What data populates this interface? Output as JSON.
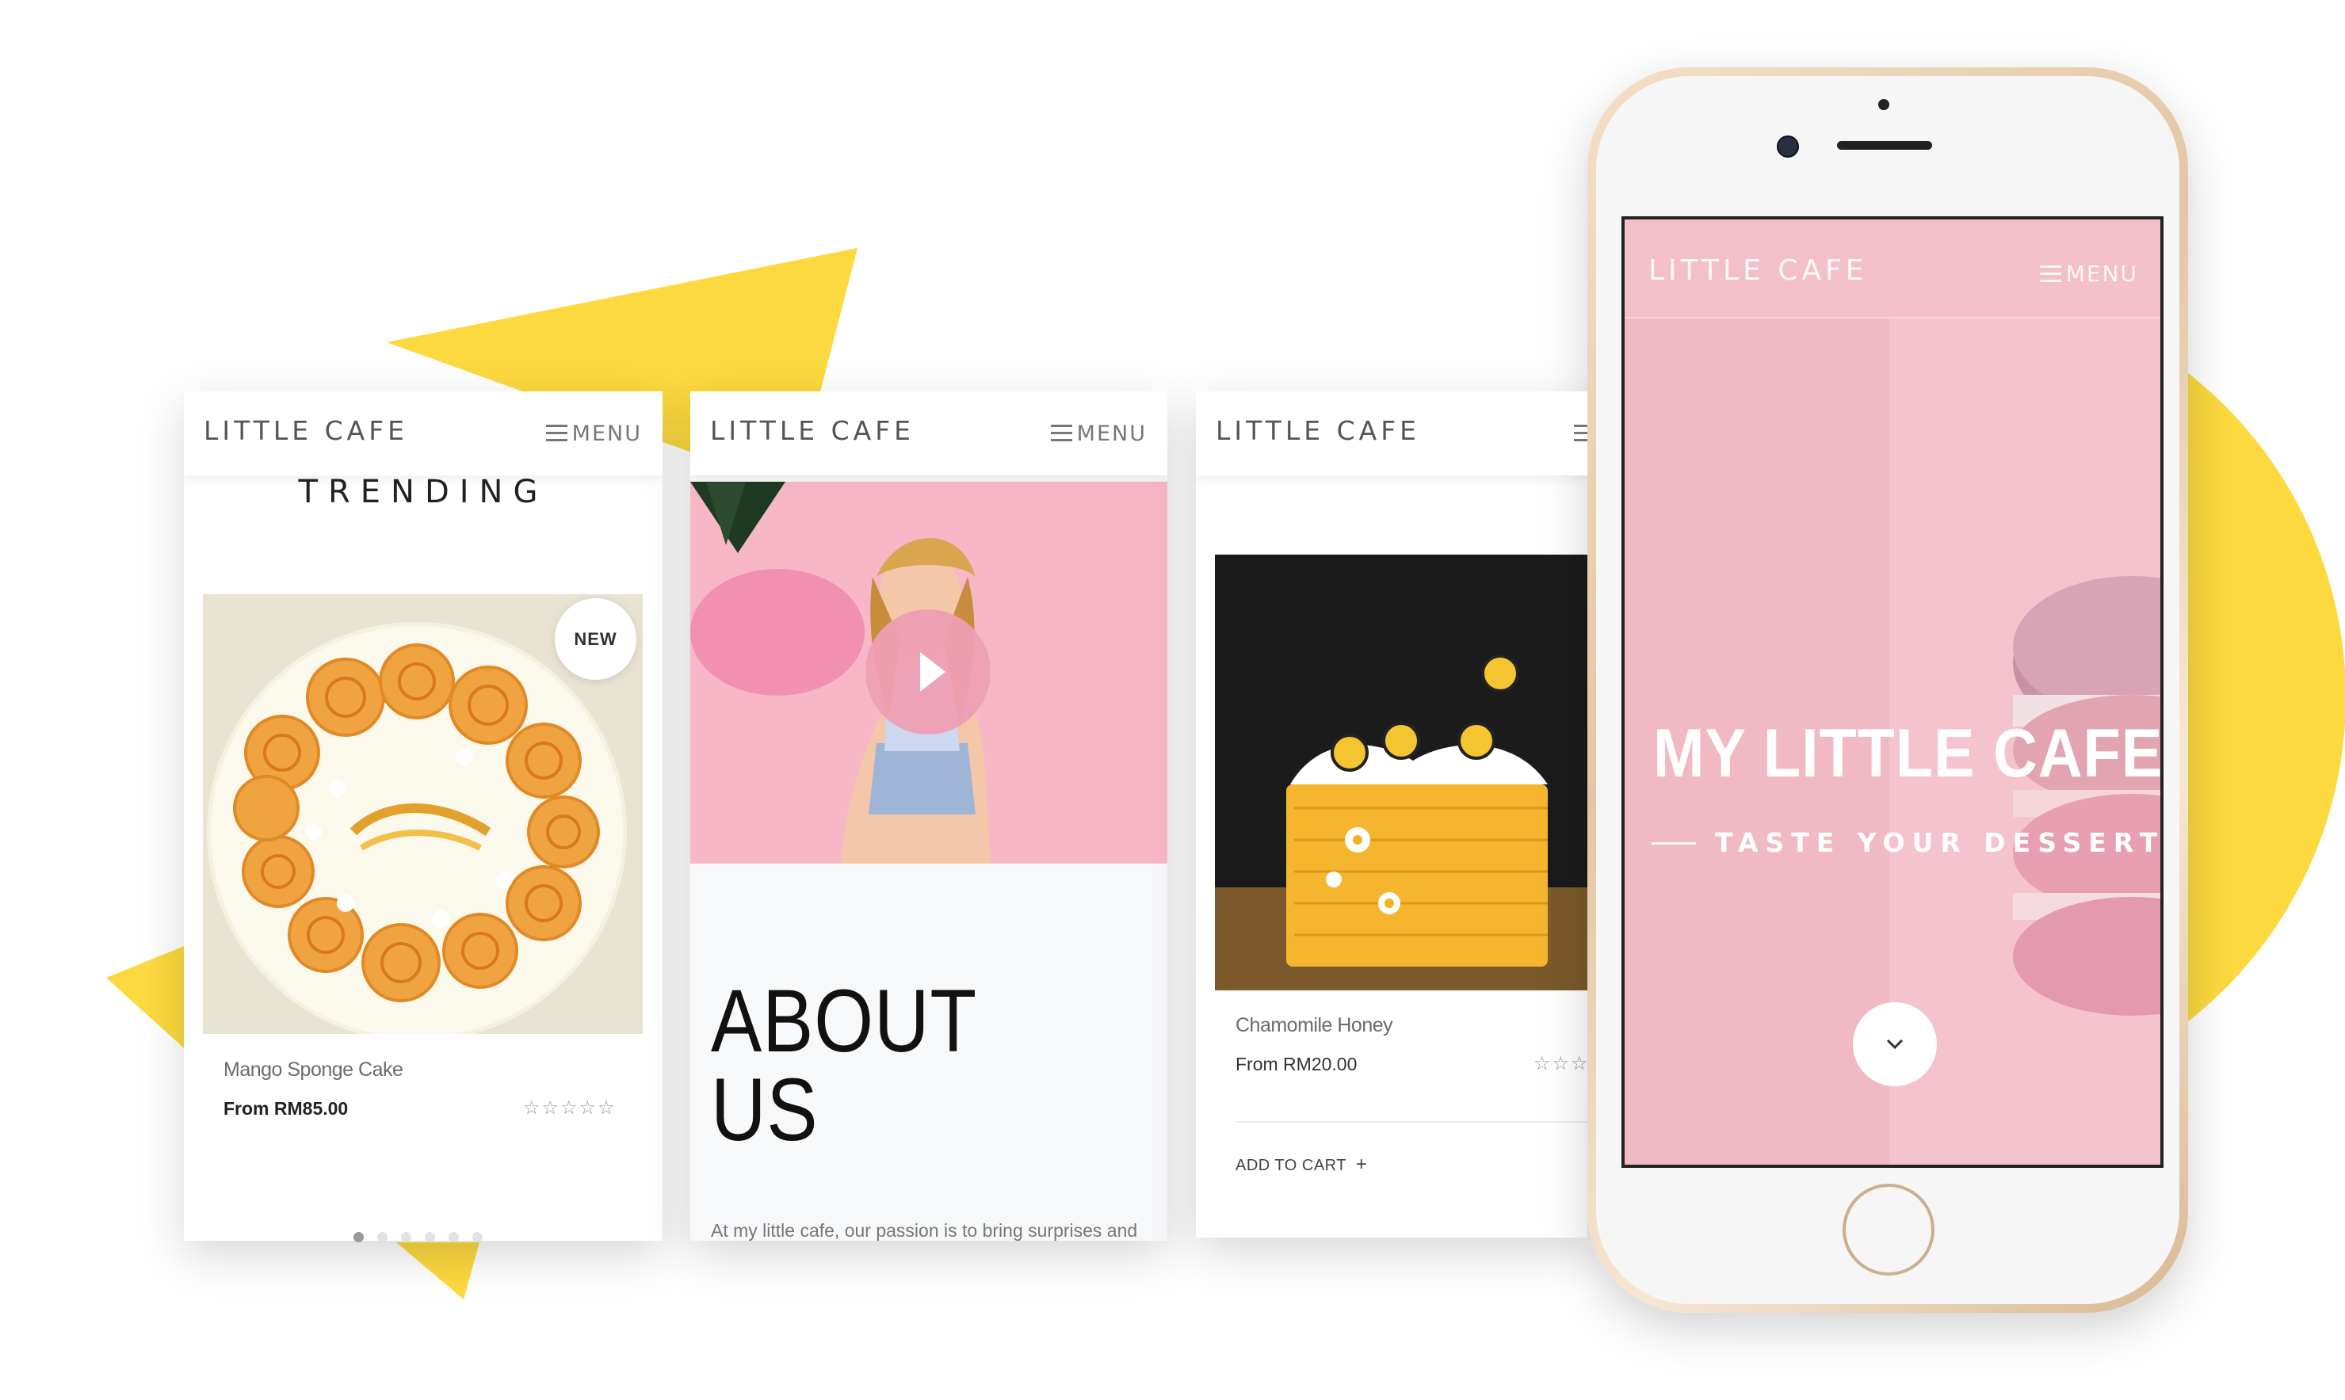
{
  "colors": {
    "accent_yellow": "#fcd93f",
    "hero_pink": "#f1b9c4",
    "video_pink": "#f7b7c6",
    "play_button": "#ee9fb4"
  },
  "screen_trending": {
    "brand": "LITTLE CAFE",
    "menu_label": "MENU",
    "section_title": "TRENDING",
    "badge": "NEW",
    "product_name": "Mango Sponge Cake",
    "product_price": "From RM85.00",
    "rating": "☆☆☆☆☆",
    "slide_count": 6,
    "active_slide": 1
  },
  "screen_about": {
    "brand": "LITTLE CAFE",
    "menu_label": "MENU",
    "heading_line1": "ABOUT",
    "heading_line2": "US",
    "intro_text": "At my little cafe, our passion is to bring surprises and"
  },
  "screen_product": {
    "brand": "LITTLE CAFE",
    "product_name": "Chamomile Honey",
    "product_price": "From RM20.00",
    "rating": "☆☆☆",
    "add_to_cart": "ADD TO CART",
    "add_icon": "+"
  },
  "phone": {
    "brand": "LITTLE CAFE",
    "menu_label": "MENU",
    "hero_title": "MY LITTLE CAFE",
    "hero_subtitle": "TASTE YOUR DESSERT",
    "scroll_icon": "chevron-down-icon"
  }
}
